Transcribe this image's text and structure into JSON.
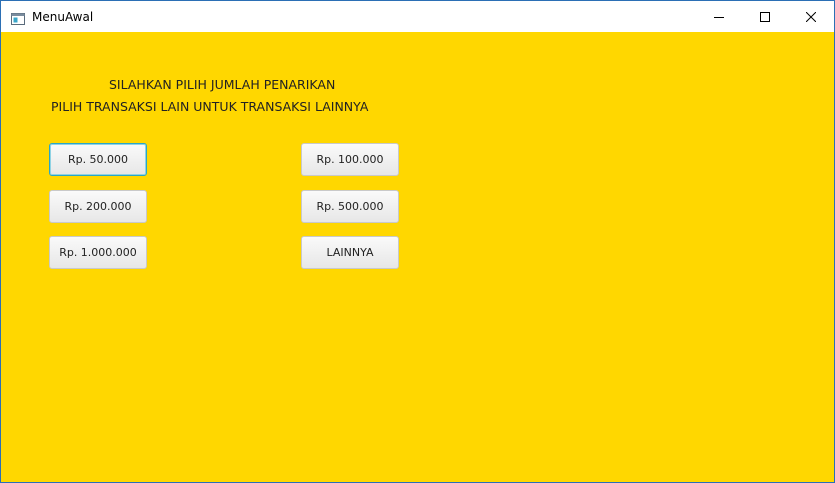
{
  "window": {
    "title": "MenuAwal",
    "icons": {
      "app": "app-window-icon",
      "minimize": "minimize-icon",
      "maximize": "maximize-icon",
      "close": "close-icon"
    }
  },
  "colors": {
    "background": "#ffd700",
    "focus_border": "#2aa6c7"
  },
  "main": {
    "heading_line1": "SILAHKAN PILIH JUMLAH PENARIKAN",
    "heading_line2": "PILIH TRANSAKSI LAIN UNTUK TRANSAKSI LAINNYA",
    "buttons": {
      "amount_50000": "Rp. 50.000",
      "amount_100000": "Rp. 100.000",
      "amount_200000": "Rp. 200.000",
      "amount_500000": "Rp. 500.000",
      "amount_1000000": "Rp. 1.000.000",
      "other": "LAINNYA"
    }
  }
}
